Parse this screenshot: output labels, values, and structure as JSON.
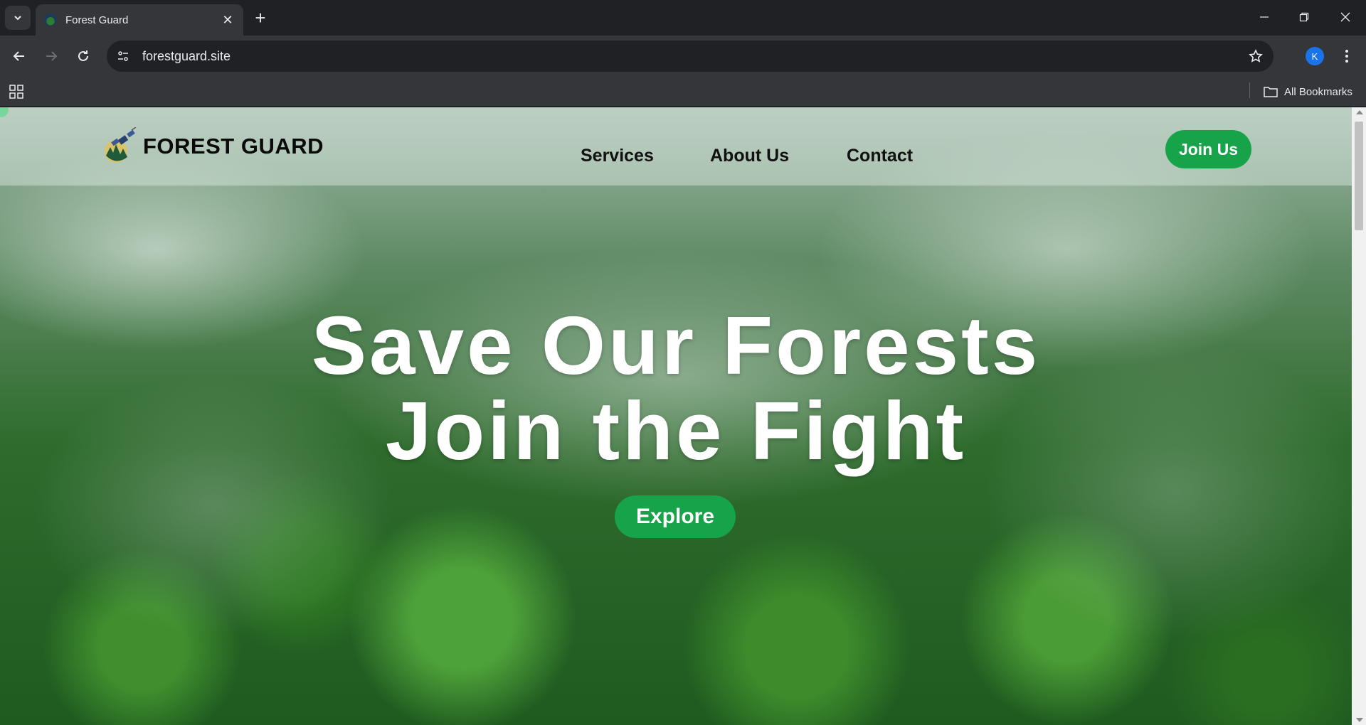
{
  "browser": {
    "tab_title": "Forest Guard",
    "url": "forestguard.site",
    "profile_initial": "K",
    "all_bookmarks_label": "All Bookmarks"
  },
  "site": {
    "brand": "FOREST GUARD",
    "nav": [
      "Services",
      "About Us",
      "Contact"
    ],
    "join_label": "Join Us",
    "hero_line1": "Save Our Forests",
    "hero_line2": "Join the Fight",
    "explore_label": "Explore",
    "accent_color": "#17a34a"
  }
}
